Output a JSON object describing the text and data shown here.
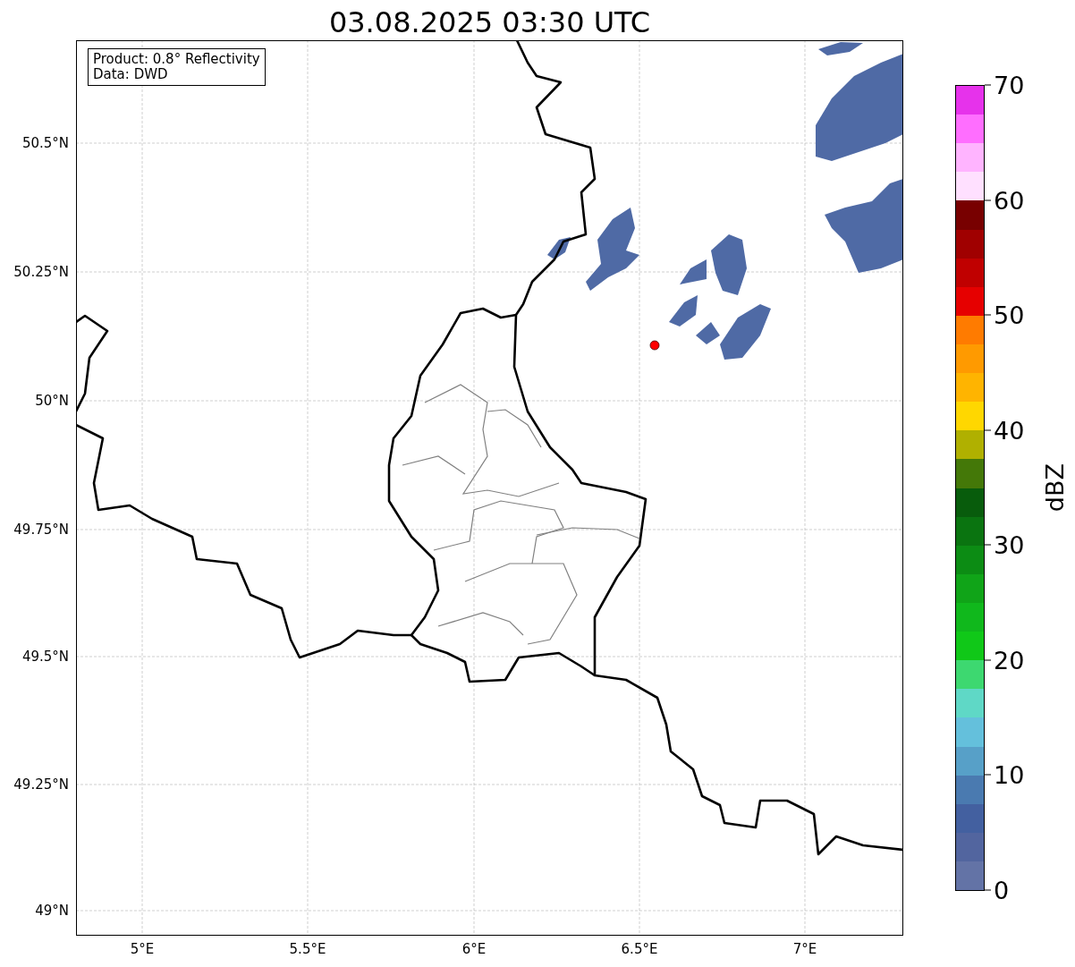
{
  "title": "03.08.2025 03:30 UTC",
  "legend": {
    "lines": [
      "Product: 0.8° Reflectivity",
      "Data: DWD"
    ]
  },
  "map": {
    "latitude_labels": [
      "50.5°N",
      "50.25°N",
      "50°N",
      "49.75°N",
      "49.5°N",
      "49.25°N",
      "49°N"
    ],
    "longitude_labels": [
      "5°E",
      "5.5°E",
      "6°E",
      "6.5°E",
      "7°E"
    ]
  },
  "colorbar": {
    "label": "dBZ",
    "tick_labels": [
      "70",
      "60",
      "50",
      "40",
      "30",
      "20",
      "10",
      "0"
    ],
    "segments": [
      {
        "color": "#e632eb"
      },
      {
        "color": "#ff6eff"
      },
      {
        "color": "#ffb4ff"
      },
      {
        "color": "#ffe0ff"
      },
      {
        "color": "#780000"
      },
      {
        "color": "#a00000"
      },
      {
        "color": "#c00000"
      },
      {
        "color": "#e60000"
      },
      {
        "color": "#ff7b00"
      },
      {
        "color": "#ff9a00"
      },
      {
        "color": "#ffb400"
      },
      {
        "color": "#ffd700"
      },
      {
        "color": "#b0b000"
      },
      {
        "color": "#447808"
      },
      {
        "color": "#085c0c"
      },
      {
        "color": "#0a7410"
      },
      {
        "color": "#0c8c14"
      },
      {
        "color": "#10a418"
      },
      {
        "color": "#10b81c"
      },
      {
        "color": "#10c818"
      },
      {
        "color": "#3dd870"
      },
      {
        "color": "#5fd8c6"
      },
      {
        "color": "#64c0dc"
      },
      {
        "color": "#57a0c8"
      },
      {
        "color": "#4a7ab0"
      },
      {
        "color": "#4360a0"
      },
      {
        "color": "#52659f"
      },
      {
        "color": "#6373a6"
      }
    ]
  }
}
